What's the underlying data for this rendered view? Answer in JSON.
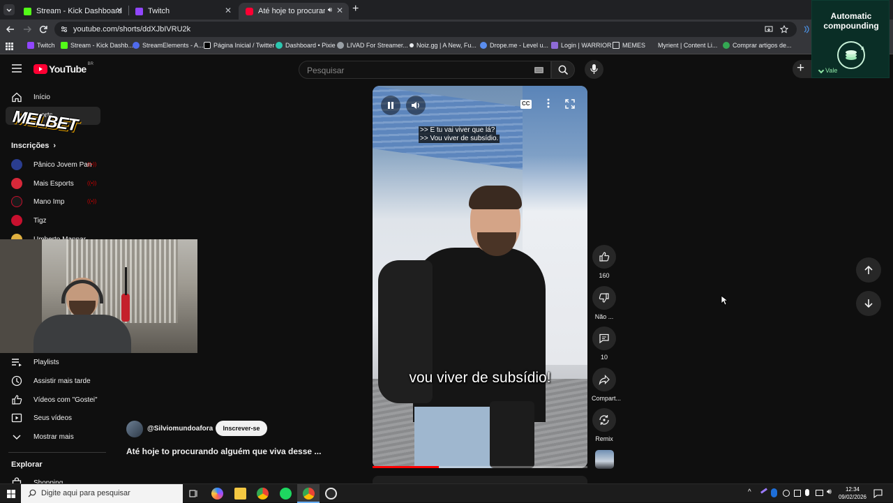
{
  "browser": {
    "tabs": [
      {
        "title": "Stream - Kick Dashboard",
        "color": "#53fc18"
      },
      {
        "title": "Twitch",
        "color": "#9146ff"
      },
      {
        "title": "Até hoje to procurando alg",
        "color": "#ff0033"
      }
    ],
    "url": "youtube.com/shorts/ddXJbIVRU2k",
    "bookmarks": [
      {
        "label": "Twitch",
        "color": "#9146ff"
      },
      {
        "label": "Stream - Kick Dashb...",
        "color": "#53fc18"
      },
      {
        "label": "StreamElements - A...",
        "color": "#4f6bed"
      },
      {
        "label": "Página Inicial / Twitter",
        "color": "#e8eaed"
      },
      {
        "label": "Dashboard • Pixie",
        "color": "#2bc7b0"
      },
      {
        "label": "LIVAD For Streamer...",
        "color": "#9aa0a6"
      },
      {
        "label": "Noiz.gg | A New, Fu...",
        "color": "#e8eaed"
      },
      {
        "label": "Drope.me - Level u...",
        "color": "#5a8dee"
      },
      {
        "label": "Login | WARRIOR",
        "color": "#8e6bd6"
      },
      {
        "label": "MEMES",
        "color": "#9aa0a6"
      },
      {
        "label": "Myrient | Content Li...",
        "color": "#9aa0a6"
      },
      {
        "label": "Comprar artigos de...",
        "color": "#34a853"
      }
    ]
  },
  "youtube": {
    "logo": "YouTube",
    "region": "BR",
    "search_placeholder": "Pesquisar",
    "sidebar": {
      "home": "Início",
      "shorts_partial": "orts",
      "subscriptions_header": "Inscrições",
      "subscriptions": [
        {
          "name": "Pânico Jovem Pan",
          "color": "#2a3d8f"
        },
        {
          "name": "Mais Esports",
          "color": "#d62839"
        },
        {
          "name": "Mano Imp",
          "color": "#1a1a1a"
        },
        {
          "name": "Tigz",
          "color": "#c8102e"
        },
        {
          "name": "Umberto Mannar",
          "color": "#e0b040"
        }
      ],
      "live_marker": "((•))",
      "you_items": [
        "Playlists",
        "Assistir mais tarde",
        "Vídeos com \"Gostei\"",
        "Seus vídeos",
        "Mostrar mais"
      ],
      "explore_header": "Explorar",
      "explore_items": [
        "Shopping"
      ]
    },
    "video": {
      "channel": "@Silviomundoafora",
      "subscribe_label": "Inscrever-se",
      "title": "Até hoje to procurando alguém que viva desse ...",
      "caption_lines": [
        ">> E tu vai viver que lá?",
        ">> Vou viver de subsídio."
      ],
      "burned_caption": "vou viver de subsídio!",
      "progress": 0.31
    },
    "actions": {
      "likes": "160",
      "dislike_label": "Não ...",
      "comments": "10",
      "share_label": "Compart...",
      "remix_label": "Remix"
    }
  },
  "overlays": {
    "sponsor_logo": "MELBET",
    "ad_title_line1": "Automatic",
    "ad_title_line2": "compounding",
    "ad_brand": "Vale"
  },
  "taskbar": {
    "search_placeholder": "Digite aqui para pesquisar",
    "time": "12:34",
    "date": "09/02/2026"
  }
}
